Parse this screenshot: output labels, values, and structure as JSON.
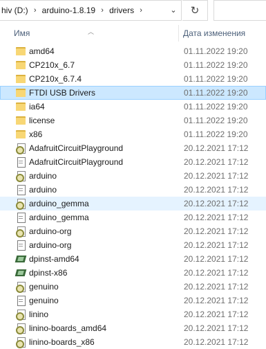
{
  "address_bar": {
    "crumbs": [
      "hiv (D:)",
      "arduino-1.8.19",
      "drivers"
    ]
  },
  "columns": {
    "name": "Имя",
    "date": "Дата изменения"
  },
  "files": [
    {
      "name": "amd64",
      "date": "01.11.2022 19:20",
      "icon": "folder-icon"
    },
    {
      "name": "CP210x_6.7",
      "date": "01.11.2022 19:20",
      "icon": "folder-icon"
    },
    {
      "name": "CP210x_6.7.4",
      "date": "01.11.2022 19:20",
      "icon": "folder-icon"
    },
    {
      "name": "FTDI USB Drivers",
      "date": "01.11.2022 19:20",
      "icon": "folder-icon",
      "state": "selected"
    },
    {
      "name": "ia64",
      "date": "01.11.2022 19:20",
      "icon": "folder-icon"
    },
    {
      "name": "license",
      "date": "01.11.2022 19:20",
      "icon": "folder-icon"
    },
    {
      "name": "x86",
      "date": "01.11.2022 19:20",
      "icon": "folder-icon"
    },
    {
      "name": "AdafruitCircuitPlayground",
      "date": "20.12.2021 17:12",
      "icon": "setup-info-icon"
    },
    {
      "name": "AdafruitCircuitPlayground",
      "date": "20.12.2021 17:12",
      "icon": "security-catalog-icon"
    },
    {
      "name": "arduino",
      "date": "20.12.2021 17:12",
      "icon": "setup-info-icon"
    },
    {
      "name": "arduino",
      "date": "20.12.2021 17:12",
      "icon": "security-catalog-icon"
    },
    {
      "name": "arduino_gemma",
      "date": "20.12.2021 17:12",
      "icon": "setup-info-icon",
      "state": "hover"
    },
    {
      "name": "arduino_gemma",
      "date": "20.12.2021 17:12",
      "icon": "security-catalog-icon"
    },
    {
      "name": "arduino-org",
      "date": "20.12.2021 17:12",
      "icon": "setup-info-icon"
    },
    {
      "name": "arduino-org",
      "date": "20.12.2021 17:12",
      "icon": "security-catalog-icon"
    },
    {
      "name": "dpinst-amd64",
      "date": "20.12.2021 17:12",
      "icon": "application-icon"
    },
    {
      "name": "dpinst-x86",
      "date": "20.12.2021 17:12",
      "icon": "application-icon"
    },
    {
      "name": "genuino",
      "date": "20.12.2021 17:12",
      "icon": "setup-info-icon"
    },
    {
      "name": "genuino",
      "date": "20.12.2021 17:12",
      "icon": "security-catalog-icon"
    },
    {
      "name": "linino",
      "date": "20.12.2021 17:12",
      "icon": "setup-info-icon"
    },
    {
      "name": "linino-boards_amd64",
      "date": "20.12.2021 17:12",
      "icon": "setup-info-icon"
    },
    {
      "name": "linino-boards_x86",
      "date": "20.12.2021 17:12",
      "icon": "setup-info-icon"
    }
  ],
  "colors": {
    "folder": "#f8d775",
    "selected_row": "#cce8ff",
    "hover_row": "#e5f3ff",
    "header_text": "#4c607a"
  }
}
